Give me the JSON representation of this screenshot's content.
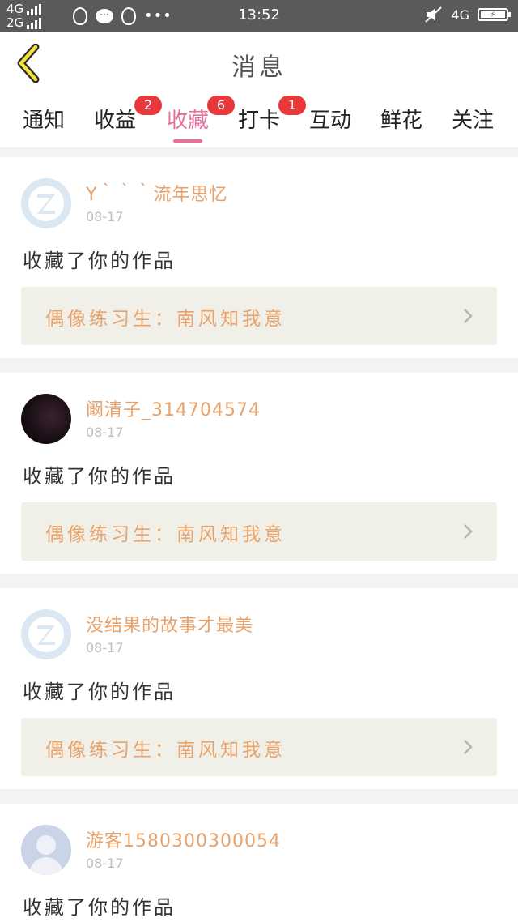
{
  "status_bar": {
    "net1": "4G",
    "net2": "2G",
    "time": "13:52",
    "net_right": "4G",
    "icons": [
      "qq-icon",
      "message-icon",
      "qq-icon",
      "more-dots-icon",
      "mute-icon",
      "battery-charging-icon"
    ]
  },
  "header": {
    "back_icon": "chevron-left-icon",
    "title": "消息"
  },
  "tabs": [
    {
      "label": "通知",
      "badge": ""
    },
    {
      "label": "收益",
      "badge": "2"
    },
    {
      "label": "收藏",
      "badge": "6",
      "active": true
    },
    {
      "label": "打卡",
      "badge": "1"
    },
    {
      "label": "互动",
      "badge": ""
    },
    {
      "label": "鲜花",
      "badge": ""
    },
    {
      "label": "关注",
      "badge": ""
    }
  ],
  "colors": {
    "accent": "#e4709c",
    "badge": "#e8383c",
    "username": "#e9a26a",
    "work_bg": "#f1f0e8"
  },
  "messages": [
    {
      "username": "Y｀｀｀流年思忆",
      "date": "08-17",
      "text": "收藏了你的作品",
      "work": "偶像练习生：南风知我意"
    },
    {
      "username": "阚清子_314704574",
      "date": "08-17",
      "text": "收藏了你的作品",
      "work": "偶像练习生：南风知我意"
    },
    {
      "username": "没结果的故事才最美",
      "date": "08-17",
      "text": "收藏了你的作品",
      "work": "偶像练习生：南风知我意"
    },
    {
      "username": "游客1580300300054",
      "date": "08-17",
      "text": "收藏了你的作品",
      "work": ""
    }
  ]
}
